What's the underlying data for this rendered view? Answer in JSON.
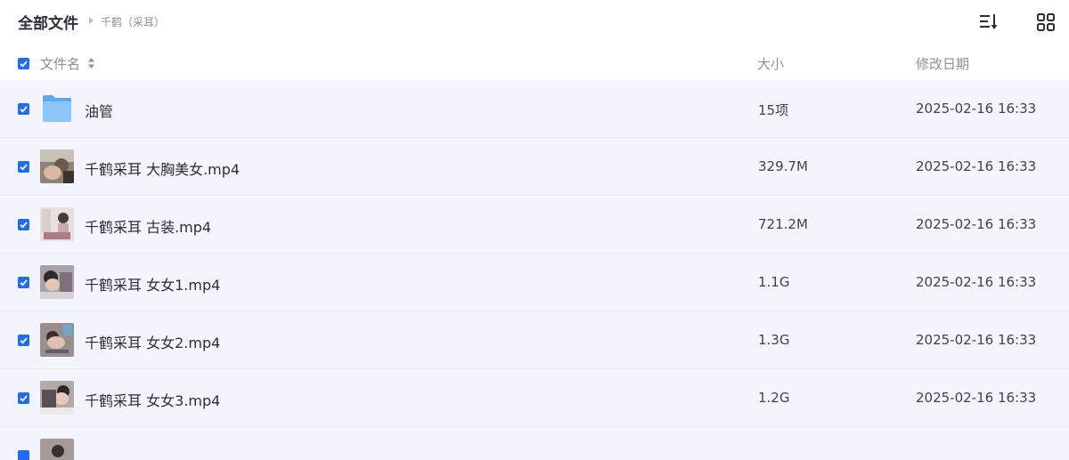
{
  "breadcrumb": {
    "root": "全部文件",
    "current": "千鹤（采耳）"
  },
  "toolbar": {
    "sort_icon": "sort-list-icon",
    "view_icon": "grid-view-icon"
  },
  "columns": {
    "name": "文件名",
    "size": "大小",
    "date": "修改日期"
  },
  "select_all_checked": true,
  "files": [
    {
      "name": "油管",
      "size": "15项",
      "date": "2025-02-16 16:33",
      "type": "folder",
      "checked": true
    },
    {
      "name": "千鹤采耳 大胸美女.mp4",
      "size": "329.7M",
      "date": "2025-02-16 16:33",
      "type": "video",
      "checked": true
    },
    {
      "name": "千鹤采耳 古装.mp4",
      "size": "721.2M",
      "date": "2025-02-16 16:33",
      "type": "video",
      "checked": true
    },
    {
      "name": "千鹤采耳 女女1.mp4",
      "size": "1.1G",
      "date": "2025-02-16 16:33",
      "type": "video",
      "checked": true
    },
    {
      "name": "千鹤采耳 女女2.mp4",
      "size": "1.3G",
      "date": "2025-02-16 16:33",
      "type": "video",
      "checked": true
    },
    {
      "name": "千鹤采耳 女女3.mp4",
      "size": "1.2G",
      "date": "2025-02-16 16:33",
      "type": "video",
      "checked": true
    }
  ],
  "colors": {
    "accent": "#1f6cf0",
    "row_bg": "#f4f5fc",
    "folder": "#7cbcf6"
  }
}
